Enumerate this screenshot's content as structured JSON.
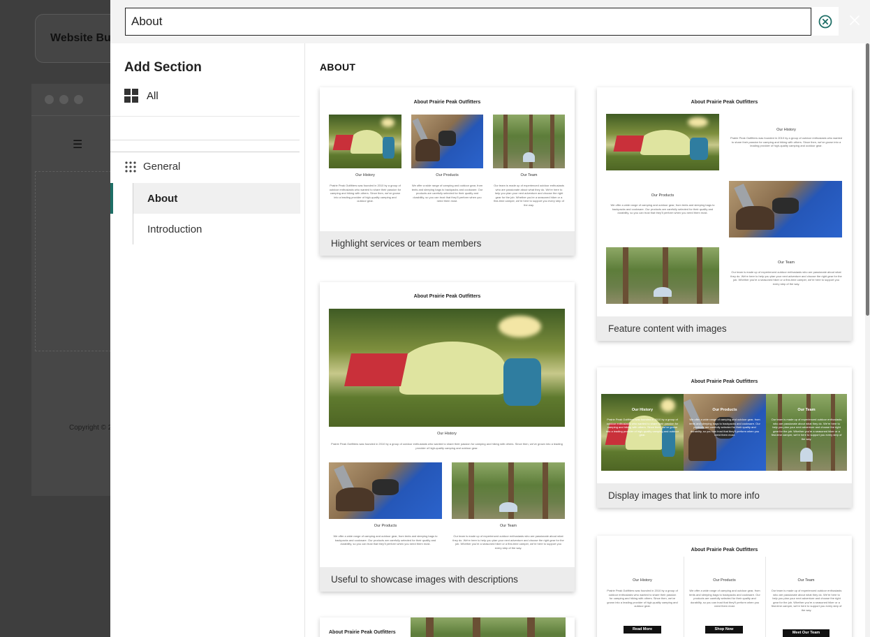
{
  "background_app": {
    "title": "Website Bu",
    "copyright": "Copyright © 2"
  },
  "search": {
    "value": "About",
    "clear_icon": "circle-x-icon",
    "close_icon": "close-icon"
  },
  "sidebar": {
    "title": "Add Section",
    "all_label": "All",
    "category_label": "General",
    "items": [
      {
        "label": "About",
        "active": true
      },
      {
        "label": "Introduction",
        "active": false
      }
    ]
  },
  "main": {
    "section_title": "ABOUT",
    "template_heading": "About Prairie Peak Outfitters",
    "labels": {
      "history": "Our History",
      "products": "Our Products",
      "team": "Our Team"
    },
    "texts": {
      "history": "Prairie Peak Outfitters was founded in 2010 by a group of outdoor enthusiasts who wanted to share their passion for camping and hiking with others. Since then, we've grown into a leading provider of high-quality camping and outdoor gear.",
      "products": "We offer a wide range of camping and outdoor gear, from tents and sleeping bags to backpacks and cookware. Our products are carefully selected for their quality and durability, so you can trust that they'll perform when you need them most.",
      "team": "Our team is made up of experienced outdoor enthusiasts who are passionate about what they do. We're here to help you plan your next adventure and choose the right gear for the job. Whether you're a seasoned hiker or a first-time camper, we're here to support you every step of the way."
    },
    "buttons": {
      "read_more": "Read More",
      "shop_now": "Shop Now",
      "meet_team": "Meet Our Team"
    },
    "cards": [
      {
        "caption": "Highlight services or team members"
      },
      {
        "caption": "Feature content with images"
      },
      {
        "caption": "Useful to showcase images with descriptions"
      },
      {
        "caption": "Display images that link to more info"
      },
      {
        "caption": ""
      },
      {
        "caption": ""
      }
    ]
  },
  "colors": {
    "accent": "#1e6e66",
    "clear_icon": "#1e6e66"
  }
}
